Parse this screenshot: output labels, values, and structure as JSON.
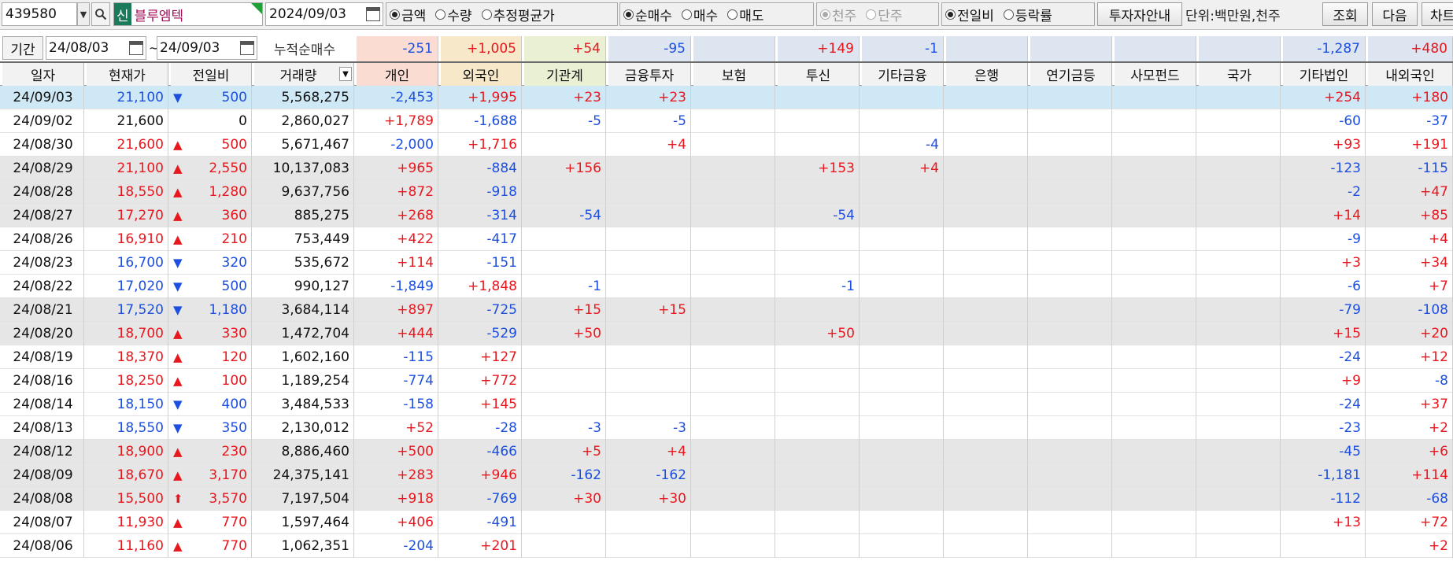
{
  "toolbar": {
    "stock_code": "439580",
    "stock_tag": "신",
    "stock_name": "블루엠텍",
    "date": "2024/09/03",
    "group1": [
      "금액",
      "수량",
      "추정평균가"
    ],
    "group2": [
      "순매수",
      "매수",
      "매도"
    ],
    "group3": [
      "천주",
      "단주"
    ],
    "group4": [
      "전일비",
      "등락률"
    ],
    "investor_guide": "투자자안내",
    "unit": "단위:백만원,천주",
    "query": "조회",
    "next": "다음",
    "chart": "차트"
  },
  "period": {
    "label": "기간",
    "from": "24/08/03",
    "tilde": "~",
    "to": "24/09/03",
    "cumulative_label": "누적순매수",
    "sums": [
      "-251",
      "+1,005",
      "+54",
      "-95",
      "",
      "+149",
      "-1",
      "",
      "",
      "",
      "",
      "-1,287",
      "+480"
    ]
  },
  "columns": [
    "일자",
    "현재가",
    "전일비",
    "거래량",
    "개인",
    "외국인",
    "기관계",
    "금융투자",
    "보험",
    "투신",
    "기타금융",
    "은행",
    "연기금등",
    "사모펀드",
    "국가",
    "기타법인",
    "내외국인"
  ],
  "rows": [
    {
      "date": "24/09/03",
      "price": "21,100",
      "dir": "down",
      "change": "500",
      "volume": "5,568,275",
      "v": [
        "-2,453",
        "+1,995",
        "+23",
        "+23",
        "",
        "",
        "",
        "",
        "",
        "",
        "",
        "+254",
        "+180"
      ]
    },
    {
      "date": "24/09/02",
      "price": "21,600",
      "dir": "flat",
      "change": "0",
      "volume": "2,860,027",
      "v": [
        "+1,789",
        "-1,688",
        "-5",
        "-5",
        "",
        "",
        "",
        "",
        "",
        "",
        "",
        "-60",
        "-37"
      ]
    },
    {
      "date": "24/08/30",
      "price": "21,600",
      "dir": "up",
      "change": "500",
      "volume": "5,671,467",
      "v": [
        "-2,000",
        "+1,716",
        "",
        "+4",
        "",
        "",
        "-4",
        "",
        "",
        "",
        "",
        "+93",
        "+191"
      ]
    },
    {
      "date": "24/08/29",
      "price": "21,100",
      "dir": "up",
      "change": "2,550",
      "volume": "10,137,083",
      "v": [
        "+965",
        "-884",
        "+156",
        "",
        "",
        "+153",
        "+4",
        "",
        "",
        "",
        "",
        "-123",
        "-115"
      ]
    },
    {
      "date": "24/08/28",
      "price": "18,550",
      "dir": "up",
      "change": "1,280",
      "volume": "9,637,756",
      "v": [
        "+872",
        "-918",
        "",
        "",
        "",
        "",
        "",
        "",
        "",
        "",
        "",
        "-2",
        "+47"
      ]
    },
    {
      "date": "24/08/27",
      "price": "17,270",
      "dir": "up",
      "change": "360",
      "volume": "885,275",
      "v": [
        "+268",
        "-314",
        "-54",
        "",
        "",
        "-54",
        "",
        "",
        "",
        "",
        "",
        "+14",
        "+85"
      ]
    },
    {
      "date": "24/08/26",
      "price": "16,910",
      "dir": "up",
      "change": "210",
      "volume": "753,449",
      "v": [
        "+422",
        "-417",
        "",
        "",
        "",
        "",
        "",
        "",
        "",
        "",
        "",
        "-9",
        "+4"
      ]
    },
    {
      "date": "24/08/23",
      "price": "16,700",
      "dir": "down",
      "change": "320",
      "volume": "535,672",
      "v": [
        "+114",
        "-151",
        "",
        "",
        "",
        "",
        "",
        "",
        "",
        "",
        "",
        "+3",
        "+34"
      ]
    },
    {
      "date": "24/08/22",
      "price": "17,020",
      "dir": "down",
      "change": "500",
      "volume": "990,127",
      "v": [
        "-1,849",
        "+1,848",
        "-1",
        "",
        "",
        "-1",
        "",
        "",
        "",
        "",
        "",
        "-6",
        "+7"
      ]
    },
    {
      "date": "24/08/21",
      "price": "17,520",
      "dir": "down",
      "change": "1,180",
      "volume": "3,684,114",
      "v": [
        "+897",
        "-725",
        "+15",
        "+15",
        "",
        "",
        "",
        "",
        "",
        "",
        "",
        "-79",
        "-108"
      ]
    },
    {
      "date": "24/08/20",
      "price": "18,700",
      "dir": "up",
      "change": "330",
      "volume": "1,472,704",
      "v": [
        "+444",
        "-529",
        "+50",
        "",
        "",
        "+50",
        "",
        "",
        "",
        "",
        "",
        "+15",
        "+20"
      ]
    },
    {
      "date": "24/08/19",
      "price": "18,370",
      "dir": "up",
      "change": "120",
      "volume": "1,602,160",
      "v": [
        "-115",
        "+127",
        "",
        "",
        "",
        "",
        "",
        "",
        "",
        "",
        "",
        "-24",
        "+12"
      ]
    },
    {
      "date": "24/08/16",
      "price": "18,250",
      "dir": "up",
      "change": "100",
      "volume": "1,189,254",
      "v": [
        "-774",
        "+772",
        "",
        "",
        "",
        "",
        "",
        "",
        "",
        "",
        "",
        "+9",
        "-8"
      ]
    },
    {
      "date": "24/08/14",
      "price": "18,150",
      "dir": "down",
      "change": "400",
      "volume": "3,484,533",
      "v": [
        "-158",
        "+145",
        "",
        "",
        "",
        "",
        "",
        "",
        "",
        "",
        "",
        "-24",
        "+37"
      ]
    },
    {
      "date": "24/08/13",
      "price": "18,550",
      "dir": "down",
      "change": "350",
      "volume": "2,130,012",
      "v": [
        "+52",
        "-28",
        "-3",
        "-3",
        "",
        "",
        "",
        "",
        "",
        "",
        "",
        "-23",
        "+2"
      ]
    },
    {
      "date": "24/08/12",
      "price": "18,900",
      "dir": "up",
      "change": "230",
      "volume": "8,886,460",
      "v": [
        "+500",
        "-466",
        "+5",
        "+4",
        "",
        "",
        "",
        "",
        "",
        "",
        "",
        "-45",
        "+6"
      ]
    },
    {
      "date": "24/08/09",
      "price": "18,670",
      "dir": "up",
      "change": "3,170",
      "volume": "24,375,141",
      "v": [
        "+283",
        "+946",
        "-162",
        "-162",
        "",
        "",
        "",
        "",
        "",
        "",
        "",
        "-1,181",
        "+114"
      ]
    },
    {
      "date": "24/08/08",
      "price": "15,500",
      "dir": "limitup",
      "change": "3,570",
      "volume": "7,197,504",
      "v": [
        "+918",
        "-769",
        "+30",
        "+30",
        "",
        "",
        "",
        "",
        "",
        "",
        "",
        "-112",
        "-68"
      ]
    },
    {
      "date": "24/08/07",
      "price": "11,930",
      "dir": "up",
      "change": "770",
      "volume": "1,597,464",
      "v": [
        "+406",
        "-491",
        "",
        "",
        "",
        "",
        "",
        "",
        "",
        "",
        "",
        "+13",
        "+72"
      ]
    },
    {
      "date": "24/08/06",
      "price": "11,160",
      "dir": "up",
      "change": "770",
      "volume": "1,062,351",
      "v": [
        "-204",
        "+201",
        "",
        "",
        "",
        "",
        "",
        "",
        "",
        "",
        "",
        "",
        "+2"
      ]
    }
  ],
  "colors": {
    "up": "#e8171e",
    "down": "#1c4fe0",
    "selected_row": "#cfe8f5",
    "shaded_row": "#e6e6e6"
  }
}
